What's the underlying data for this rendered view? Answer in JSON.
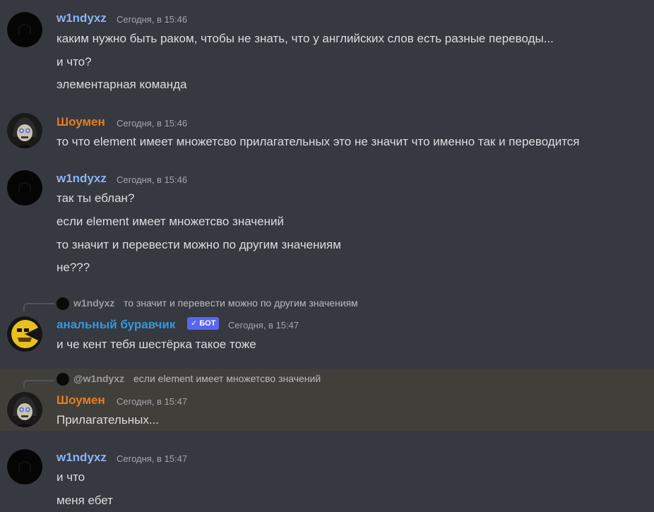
{
  "colors": {
    "background": "#36393f",
    "highlight_background": "#413f3a",
    "windyxz_name": "#8ab4f8",
    "showmen_name": "#e67e22",
    "bot_name": "#3498db",
    "bot_badge": "#5865f2",
    "text": "#dcddde",
    "timestamp": "#a3a6aa"
  },
  "messages": [
    {
      "author": "w1ndyxz",
      "avatar_icon": "black-circle-avatar-icon",
      "timestamp": "Сегодня, в 15:46",
      "lines": [
        "каким нужно быть раком, чтобы не знать, что у английских слов есть разные переводы...",
        "и что?",
        "элементарная команда"
      ]
    },
    {
      "author": "Шоумен",
      "avatar_icon": "skull-avatar-icon",
      "timestamp": "Сегодня, в 15:46",
      "lines": [
        "то что element  имеет множетсво прилагательных это не значит что именно так и переводится"
      ]
    },
    {
      "author": "w1ndyxz",
      "avatar_icon": "black-circle-avatar-icon",
      "timestamp": "Сегодня, в 15:46",
      "lines": [
        "так ты еблан?",
        "если element имеет множетсво значений",
        "то значит и перевести можно по другим значениям",
        "не???"
      ]
    },
    {
      "reply": {
        "author": "w1ndyxz",
        "text": "то значит и перевести можно по другим значениям"
      },
      "author": "анальный буравчик",
      "avatar_icon": "pacman-avatar-icon",
      "bot_badge": "✓ БОТ",
      "timestamp": "Сегодня, в 15:47",
      "lines": [
        "и че кент тебя шестёрка такое тоже"
      ]
    },
    {
      "reply": {
        "author": "@w1ndyxz",
        "text": "если element имеет множетсво значений"
      },
      "author": "Шоумен",
      "avatar_icon": "skull-avatar-icon",
      "timestamp": "Сегодня, в 15:47",
      "lines": [
        "Прилагательных..."
      ]
    },
    {
      "author": "w1ndyxz",
      "avatar_icon": "black-circle-avatar-icon",
      "timestamp": "Сегодня, в 15:47",
      "lines": [
        "и что",
        "меня ебет"
      ]
    }
  ]
}
